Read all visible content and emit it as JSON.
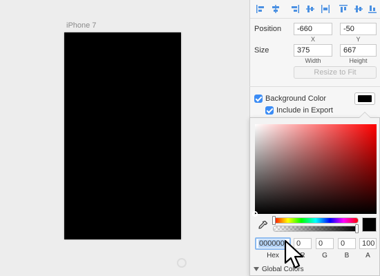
{
  "canvas": {
    "artboard_label": "iPhone 7",
    "artboard_fill": "#000000"
  },
  "alignment_toolbar": {
    "icons": [
      "align-left-icon",
      "align-horizontal-center-icon",
      "align-right-icon",
      "distribute-horizontal-icon",
      "align-top-icon",
      "align-vertical-center-icon",
      "align-bottom-icon",
      "distribute-vertical-icon"
    ]
  },
  "inspector": {
    "position": {
      "label": "Position",
      "x": "-660",
      "y": "-50",
      "x_label": "X",
      "y_label": "Y"
    },
    "size": {
      "label": "Size",
      "width": "375",
      "height": "667",
      "width_label": "Width",
      "height_label": "Height"
    },
    "resize_button": "Resize to Fit",
    "background_color": {
      "label": "Background Color",
      "checked": true,
      "swatch": "#000000"
    },
    "include_in_export": {
      "label": "Include in Export",
      "checked": true
    }
  },
  "color_picker": {
    "hex": "000000",
    "r": "0",
    "g": "0",
    "b": "0",
    "a": "100",
    "hex_label": "Hex",
    "r_label": "R",
    "g_label": "G",
    "b_label": "B",
    "a_label": "A",
    "global_colors_label": "Global Colors",
    "accent": "#3b8cf5"
  }
}
